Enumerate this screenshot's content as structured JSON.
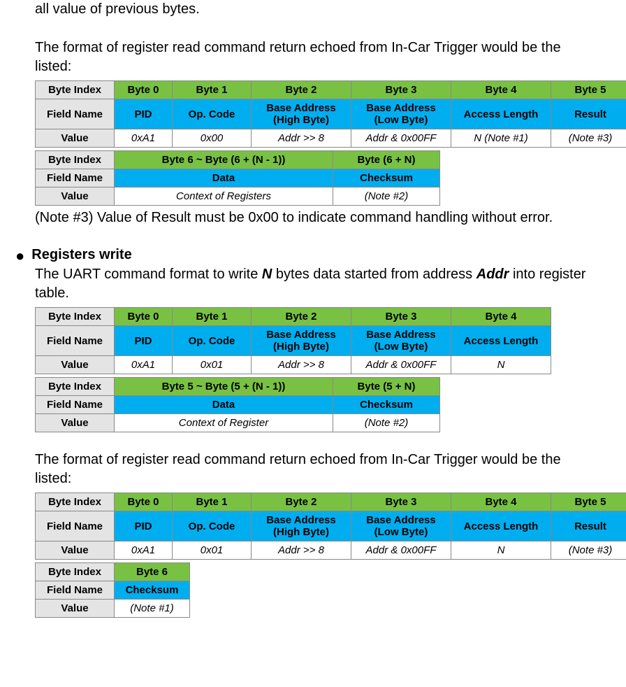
{
  "para": {
    "top": "all value of previous bytes.",
    "return_intro1": "The format of register read command return echoed from In-Car Trigger would be the listed:",
    "note3": "(Note #3) Value of Result must be 0x00 to indicate command handling without error.",
    "regw_title": "Registers write",
    "regw_intro_a": "The UART command format to write ",
    "regw_intro_n": "N",
    "regw_intro_b": " bytes data started from address ",
    "regw_intro_addr": "Addr",
    "regw_intro_c": " into register table.",
    "return_intro2": "The format of register read command return echoed from In-Car Trigger would be the listed:"
  },
  "labels": {
    "byte_index": "Byte Index",
    "field_name": "Field Name",
    "value": "Value"
  },
  "t1a": {
    "h": [
      "Byte 0",
      "Byte 1",
      "Byte 2",
      "Byte 3",
      "Byte 4",
      "Byte 5"
    ],
    "f": [
      "PID",
      "Op. Code",
      "Base Address (High Byte)",
      "Base Address (Low Byte)",
      "Access Length",
      "Result"
    ],
    "v": [
      "0xA1",
      "0x00",
      "Addr >> 8",
      "Addr & 0x00FF",
      "N (Note #1)",
      "(Note #3)"
    ]
  },
  "t1b": {
    "h": [
      "Byte 6 ~ Byte (6 + (N - 1))",
      "Byte (6 + N)"
    ],
    "f": [
      "Data",
      "Checksum"
    ],
    "v": [
      "Context of Registers",
      "(Note #2)"
    ]
  },
  "t2a": {
    "h": [
      "Byte 0",
      "Byte 1",
      "Byte 2",
      "Byte 3",
      "Byte 4"
    ],
    "f": [
      "PID",
      "Op. Code",
      "Base Address (High Byte)",
      "Base Address (Low Byte)",
      "Access Length"
    ],
    "v": [
      "0xA1",
      "0x01",
      "Addr >> 8",
      "Addr & 0x00FF",
      "N"
    ]
  },
  "t2b": {
    "h": [
      "Byte 5 ~ Byte (5 + (N - 1))",
      "Byte (5 + N)"
    ],
    "f": [
      "Data",
      "Checksum"
    ],
    "v": [
      "Context of Register",
      "(Note #2)"
    ]
  },
  "t3a": {
    "h": [
      "Byte 0",
      "Byte 1",
      "Byte 2",
      "Byte 3",
      "Byte 4",
      "Byte 5"
    ],
    "f": [
      "PID",
      "Op. Code",
      "Base Address (High Byte)",
      "Base Address (Low Byte)",
      "Access Length",
      "Result"
    ],
    "v": [
      "0xA1",
      "0x01",
      "Addr >> 8",
      "Addr & 0x00FF",
      "N",
      "(Note #3)"
    ]
  },
  "t3b": {
    "h": [
      "Byte 6"
    ],
    "f": [
      "Checksum"
    ],
    "v": [
      "(Note #1)"
    ]
  }
}
